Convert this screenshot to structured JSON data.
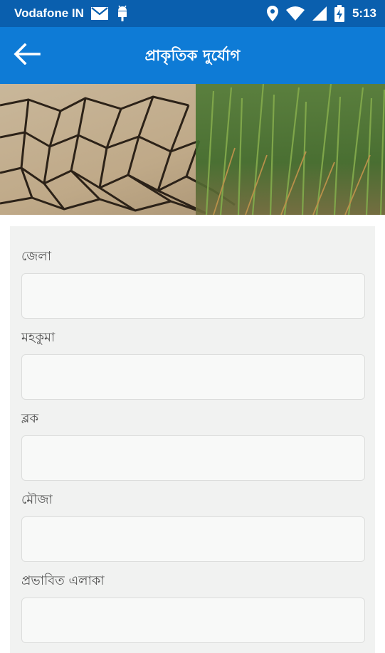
{
  "status_bar": {
    "carrier": "Vodafone IN",
    "time": "5:13",
    "icons": [
      "gmail-icon",
      "android-debug-icon",
      "location-icon",
      "wifi-icon",
      "cell-signal-icon",
      "battery-charging-icon"
    ]
  },
  "app_bar": {
    "title": "প্রাকৃতিক দুর্যোগ",
    "back_icon": "arrow-back-icon",
    "color": "#0e7bd6",
    "status_color": "#0a5fae"
  },
  "hero": {
    "image": "drought-cracked-soil-and-paddy"
  },
  "form": {
    "fields": [
      {
        "label": "জেলা",
        "value": ""
      },
      {
        "label": "মহকুমা",
        "value": ""
      },
      {
        "label": "ব্লক",
        "value": ""
      },
      {
        "label": "মৌজা",
        "value": ""
      },
      {
        "label": "প্রভাবিত এলাকা",
        "value": ""
      }
    ]
  }
}
